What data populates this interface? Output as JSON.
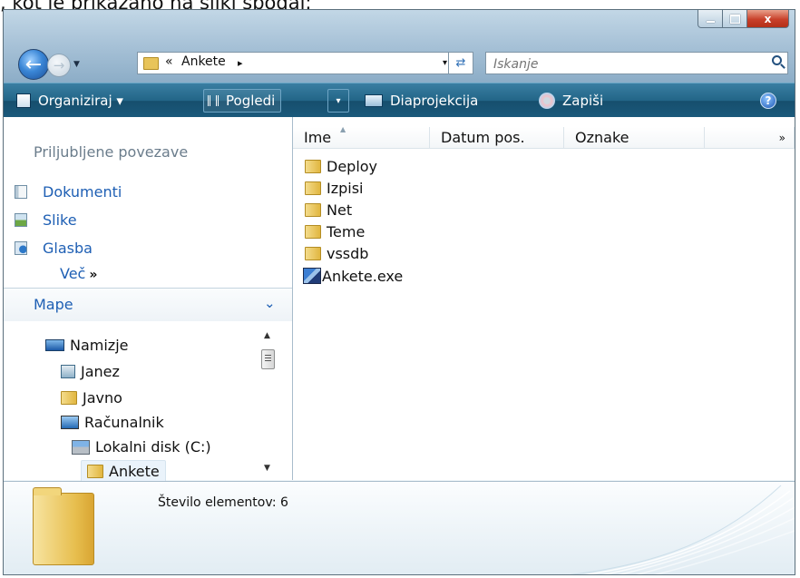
{
  "caption": ", kot je prikazano na sliki spodaj:",
  "titlebar": {
    "minimize_icon": "minimize-icon",
    "maximize_icon": "maximize-icon",
    "close_glyph": "x"
  },
  "address": {
    "overflow": "«",
    "crumbs": [
      "Ankete"
    ],
    "separator": "▸",
    "dropdown": "▾"
  },
  "search": {
    "placeholder": "Iskanje"
  },
  "toolbar": {
    "organize": "Organiziraj ▾",
    "views": "Pogledi",
    "views_dropdown": "▾",
    "slideshow": "Diaprojekcija",
    "burn": "Zapiši",
    "help": "?"
  },
  "navpane": {
    "favorites_title": "Priljubljene povezave",
    "favorites": [
      {
        "label": "Dokumenti",
        "icon": "documents-icon"
      },
      {
        "label": "Slike",
        "icon": "pictures-icon"
      },
      {
        "label": "Glasba",
        "icon": "music-icon"
      }
    ],
    "more": "Več",
    "more_glyph": "»",
    "folders_title": "Mape",
    "tree": [
      {
        "label": "Namizje",
        "icon": "desktop-icon"
      },
      {
        "label": "Janez",
        "icon": "user-folder-icon"
      },
      {
        "label": "Javno",
        "icon": "folder-icon"
      },
      {
        "label": "Računalnik",
        "icon": "computer-icon"
      },
      {
        "label": "Lokalni disk (C:)",
        "icon": "disk-icon"
      },
      {
        "label": "Ankete",
        "icon": "folder-icon"
      }
    ]
  },
  "list": {
    "columns": [
      "Ime",
      "Datum pos.",
      "Oznake"
    ],
    "more_columns": "»",
    "items": [
      {
        "name": "Deploy",
        "icon": "folder-icon"
      },
      {
        "name": "Izpisi",
        "icon": "folder-icon"
      },
      {
        "name": "Net",
        "icon": "folder-icon"
      },
      {
        "name": "Teme",
        "icon": "folder-icon"
      },
      {
        "name": "vssdb",
        "icon": "folder-icon"
      },
      {
        "name": "Ankete.exe",
        "icon": "exe-icon"
      }
    ]
  },
  "details": {
    "count": "Število elementov: 6"
  },
  "colors": {
    "toolbar": "#1f5f82",
    "link": "#1e5fb4",
    "close": "#c8402a"
  }
}
